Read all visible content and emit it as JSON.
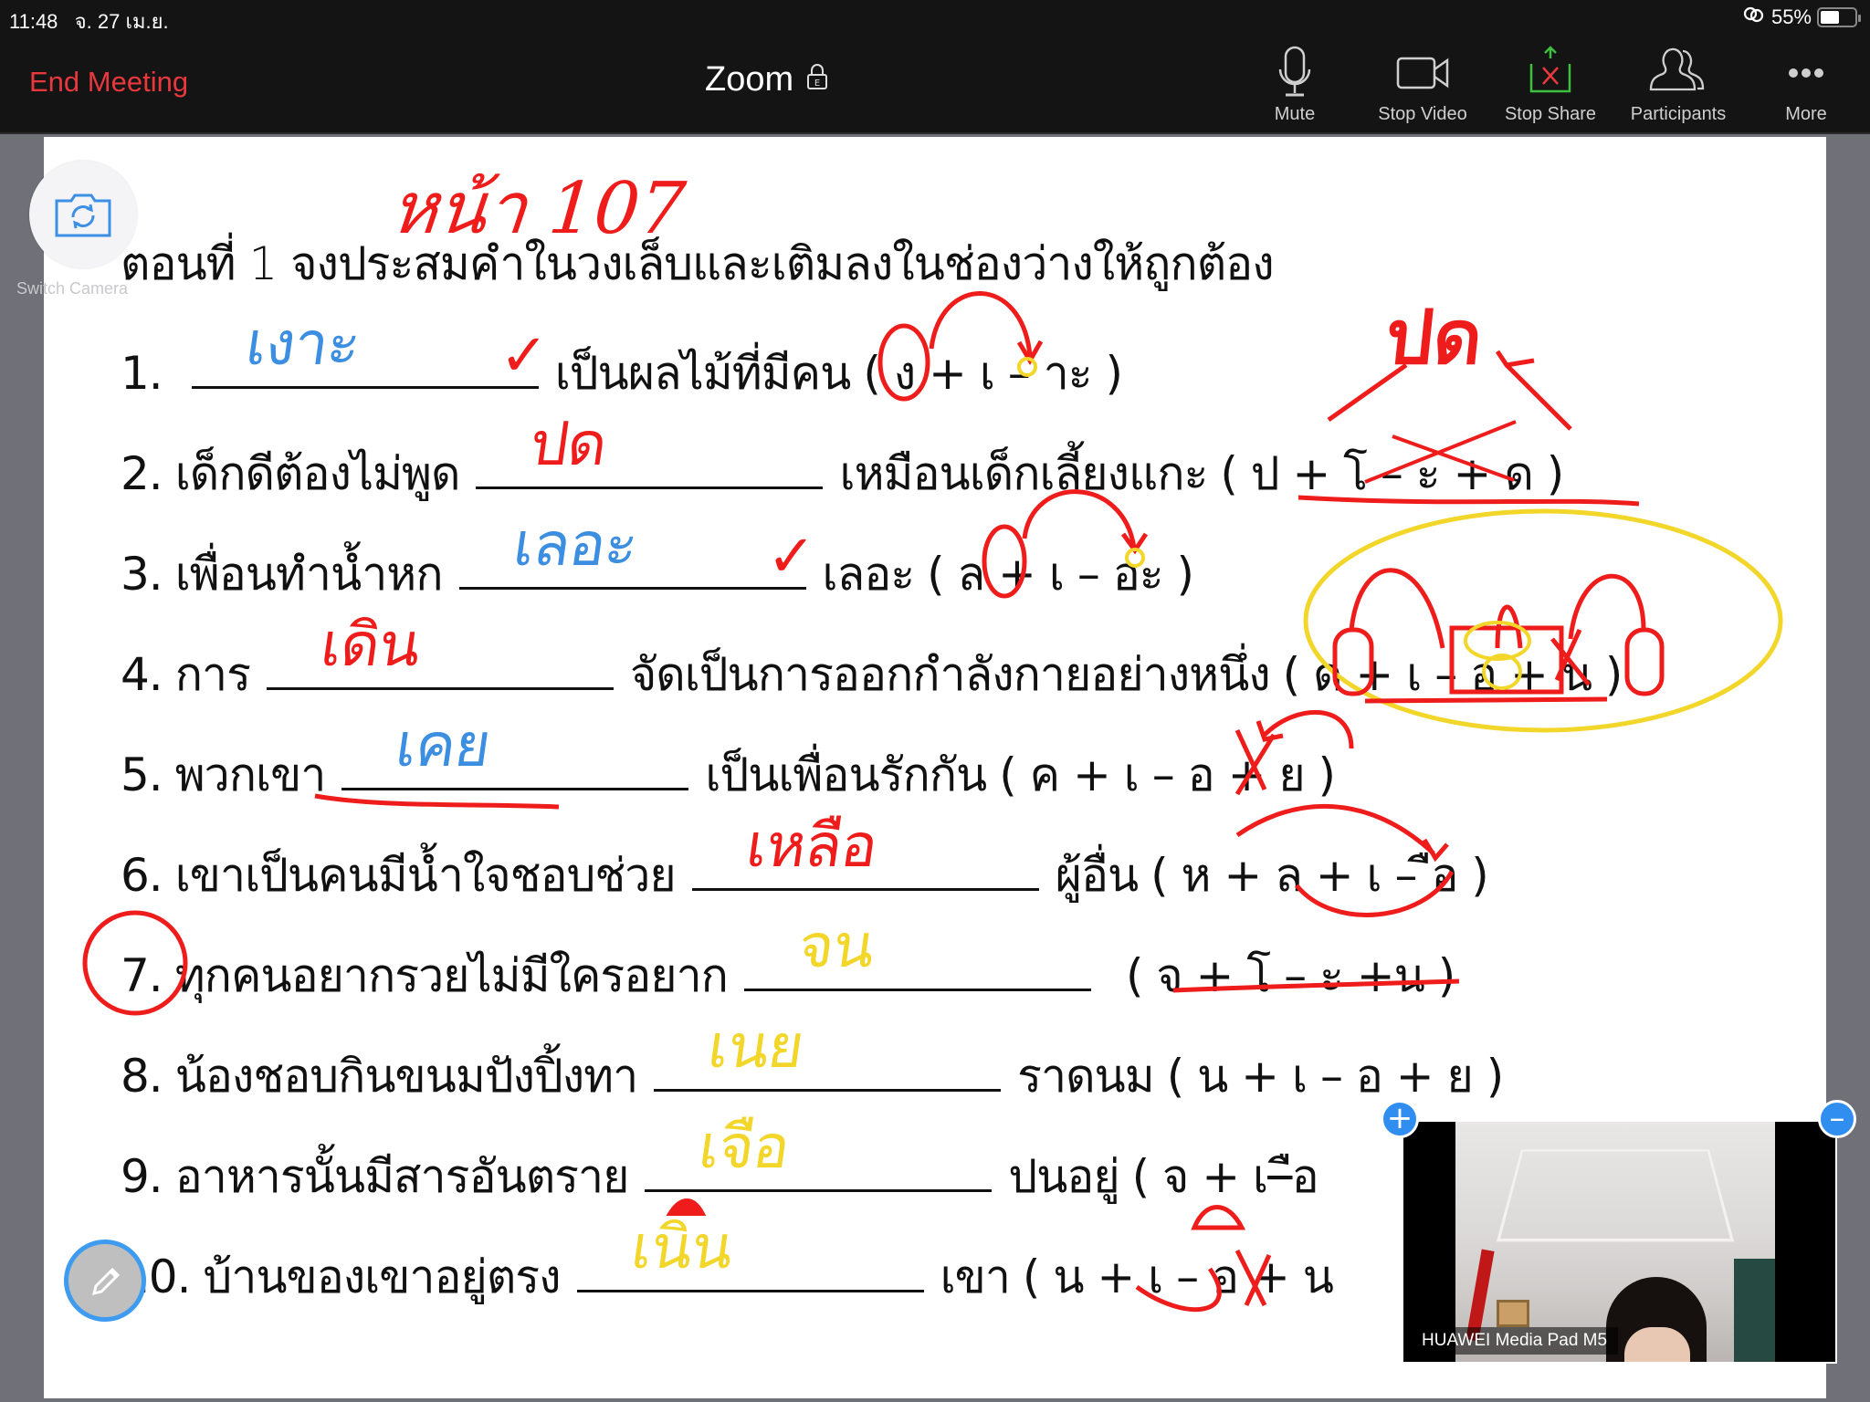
{
  "status_bar": {
    "time": "11:48",
    "date": "จ. 27 เม.ย.",
    "battery_percent_label": "55%",
    "battery_level": 0.55
  },
  "meeting": {
    "end_label": "End Meeting",
    "title": "Zoom",
    "lock_icon": "encrypted-lock-icon"
  },
  "toolbar": [
    {
      "label": "Mute",
      "icon": "microphone-icon"
    },
    {
      "label": "Stop Video",
      "icon": "video-camera-icon"
    },
    {
      "label": "Stop Share",
      "icon": "share-screen-icon"
    },
    {
      "label": "Participants",
      "icon": "participants-icon"
    },
    {
      "label": "More",
      "icon": "more-dots-icon"
    }
  ],
  "shared_content": {
    "page_reference": "หน้า 107",
    "heading": "ตอนที่ 1 จงประสมคำในวงเล็บและเติมลงในช่องว่างให้ถูกต้อง",
    "exercises": [
      {
        "number": "1.",
        "before": "",
        "after": "เป็นผลไม้ที่มีคน",
        "formula": "( ง + เ – าะ )",
        "answer": "เงาะ",
        "answer_color": "blue",
        "mark": "✓"
      },
      {
        "number": "2.",
        "before": "เด็กดีต้องไม่พูด",
        "after": "เหมือนเด็กเลี้ยงแกะ",
        "formula": "( ป + โ – ะ + ด )",
        "answer": "ปด",
        "answer_color": "red",
        "mark": ""
      },
      {
        "number": "3.",
        "before": "เพื่อนทำน้ำหก",
        "after": "เลอะ",
        "formula": "( ล + เ – อะ )",
        "answer": "เลอะ",
        "answer_color": "blue",
        "mark": "✓"
      },
      {
        "number": "4.",
        "before": "การ",
        "after": "จัดเป็นการออกกำลังกายอย่างหนึ่ง",
        "formula": "( ด + เ – อ + น )",
        "answer": "เดิน",
        "answer_color": "red",
        "mark": ""
      },
      {
        "number": "5.",
        "before": "พวกเขา",
        "after": "เป็นเพื่อนรักกัน",
        "formula": "( ค + เ – อ + ย )",
        "answer": "เคย",
        "answer_color": "blue",
        "mark": ""
      },
      {
        "number": "6.",
        "before": "เขาเป็นคนมีน้ำใจชอบช่วย",
        "after": "ผู้อื่น",
        "formula": "( ห + ล + เ – ือ )",
        "answer": "เหลือ",
        "answer_color": "red",
        "mark": ""
      },
      {
        "number": "7.",
        "before": "ทุกคนอยากรวยไม่มีใครอยาก",
        "after": "",
        "formula": "( จ + โ – ะ +น )",
        "answer": "จน",
        "answer_color": "yellow",
        "mark": ""
      },
      {
        "number": "8.",
        "before": "น้องชอบกินขนมปังปิ้งทา",
        "after": "ราดนม",
        "formula": "( น + เ – อ + ย )",
        "answer": "เนย",
        "answer_color": "yellow",
        "mark": ""
      },
      {
        "number": "9.",
        "before": "อาหารนั้นมีสารอันตราย",
        "after": "ปนอยู่",
        "formula": "( จ + เ–ือ",
        "answer": "เจือ",
        "answer_color": "yellow",
        "mark": ""
      },
      {
        "number": "10.",
        "before": "บ้านของเขาอยู่ตรง",
        "after": "เขา",
        "formula": "( น + เ – อ + น",
        "answer": "เนิน",
        "answer_color": "yellow",
        "mark": ""
      }
    ],
    "side_annotation": "ปด"
  },
  "controls": {
    "switch_camera_label": "Switch Camera",
    "annotate_icon": "pencil-icon"
  },
  "video_thumbnail": {
    "device_label": "HUAWEI Media Pad M5",
    "expand_symbol": "+",
    "collapse_symbol": "–"
  }
}
